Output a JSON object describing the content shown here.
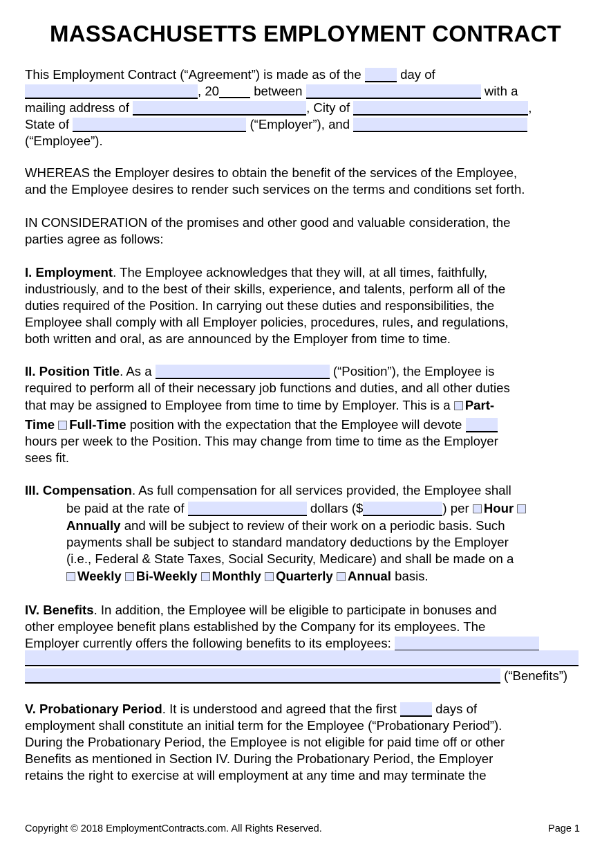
{
  "title": "MASSACHUSETTS EMPLOYMENT CONTRACT",
  "intro": {
    "l1a": "This Employment Contract (“Agreement”) is made as of the",
    "l1b": "day of",
    "l2a": ", 20",
    "l2b": "between",
    "l2c": "with a",
    "l3a": "mailing address of",
    "l3b": ", City of",
    "l3c": ",",
    "l4a": "State of",
    "l4b": "(“Employer”), and",
    "l5": "(“Employee”)."
  },
  "whereas": [
    "WHEREAS the Employer desires to obtain the benefit of the services of the Employee,",
    "and the Employee desires to render such services on the terms and conditions set forth."
  ],
  "consideration": [
    "IN CONSIDERATION of the promises and other good and valuable consideration, the",
    "parties agree as follows:"
  ],
  "s1": {
    "heading": "I. Employment",
    "lines": [
      ". The Employee acknowledges that they will, at all times, faithfully,",
      "industriously, and to the best of their skills, experience, and talents, perform all of the",
      "duties required of the Position. In carrying out these duties and responsibilities, the",
      "Employee shall comply with all Employer policies, procedures, rules, and regulations,",
      "both written and oral, as are announced by the Employer from time to time."
    ]
  },
  "s2": {
    "heading": "II. Position Title",
    "l1a": ". As a",
    "l1b": "(“Position”), the Employee is",
    "l2": "required to perform all of their necessary job functions and duties, and all other duties",
    "l3": "that may be assigned to Employee from time to time by Employer. This is a",
    "opt_part_a": "Part-",
    "opt_part_b": "Time",
    "opt_full": "Full-Time",
    "l4": "position with the expectation that the Employee will devote",
    "l5": "hours per week to the Position. This may change from time to time as the Employer",
    "l6": "sees fit."
  },
  "s3": {
    "heading": "III. Compensation",
    "l1": ". As full compensation for all services provided, the Employee shall",
    "l2a": "be paid at the rate of",
    "l2b": "dollars ($",
    "l2c": ") per",
    "opt_hour": "Hour",
    "opt_annually": "Annually",
    "l3": "and will be subject to review of their work on a periodic basis. Such",
    "l4": "payments shall be subject to standard mandatory deductions by the Employer",
    "l5": "(i.e., Federal & State Taxes, Social Security, Medicare) and shall be made on a",
    "opt_weekly": "Weekly",
    "opt_biweekly": "Bi-Weekly",
    "opt_monthly": "Monthly",
    "opt_quarterly": "Quarterly",
    "opt_annual": "Annual",
    "l6end": "basis."
  },
  "s4": {
    "heading": "IV. Benefits",
    "l1": ". In addition, the Employee will be eligible to participate in bonuses and",
    "l2": "other employee benefit plans established by the Company for its employees. The",
    "l3": "Employer currently offers the following benefits to its employees:",
    "l5end": "(“Benefits”)"
  },
  "s5": {
    "heading": "V. Probationary Period",
    "l1a": ". It is understood and agreed that the first",
    "l1b": "days of",
    "l2": "employment shall constitute an initial term for the Employee (“Probationary Period”).",
    "l3": "During the Probationary Period, the Employee is not eligible for paid time off or other",
    "l4": "Benefits as mentioned in Section IV. During the Probationary Period, the Employer",
    "l5": "retains the right to exercise at will employment at any time and may terminate the"
  },
  "footer": {
    "copyright": "Copyright © 2018 EmploymentContracts.com. All Rights Reserved.",
    "page": "Page 1"
  },
  "fields": {
    "day": "",
    "month": "",
    "year": "",
    "employer_name": "",
    "employer_address": "",
    "employer_city": "",
    "employer_state": "",
    "employee_name": "",
    "position": "",
    "hours_per_week": "",
    "rate_words": "",
    "rate_amount": "",
    "benefits_1": "",
    "benefits_2": "",
    "benefits_3": "",
    "probation_days": ""
  },
  "colors": {
    "field_fill": "#dde3ff"
  }
}
